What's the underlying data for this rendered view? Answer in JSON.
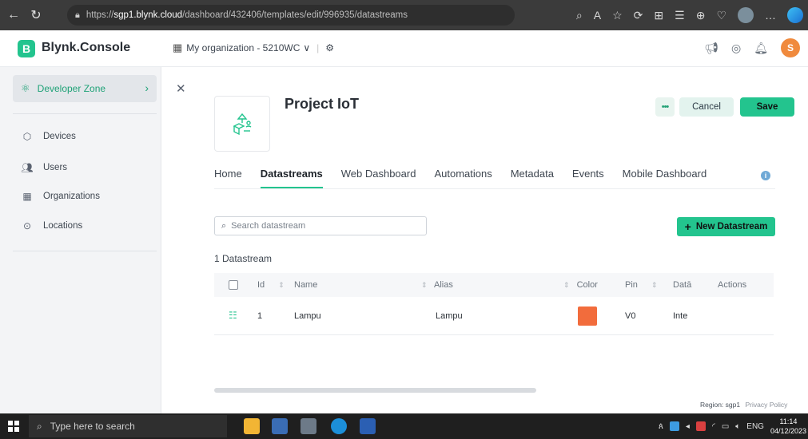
{
  "browser": {
    "url_prefix": "https://",
    "url_host": "sgp1.blynk.cloud",
    "url_path": "/dashboard/432406/templates/edit/996935/datastreams"
  },
  "header": {
    "logo_letter": "B",
    "app_name": "Blynk.Console",
    "org_name": "My organization - 5210WC",
    "user_initial": "S"
  },
  "sidebar": {
    "developer_zone": "Developer Zone",
    "items": [
      {
        "label": "Devices",
        "icon": "cube-icon"
      },
      {
        "label": "Users",
        "icon": "users-icon"
      },
      {
        "label": "Organizations",
        "icon": "building-icon"
      },
      {
        "label": "Locations",
        "icon": "location-pin-icon"
      }
    ]
  },
  "main": {
    "project_title": "Project IoT",
    "more_label": "•••",
    "cancel_label": "Cancel",
    "save_label": "Save",
    "tabs": [
      {
        "label": "Home",
        "active": false
      },
      {
        "label": "Datastreams",
        "active": true
      },
      {
        "label": "Web Dashboard",
        "active": false
      },
      {
        "label": "Automations",
        "active": false
      },
      {
        "label": "Metadata",
        "active": false
      },
      {
        "label": "Events",
        "active": false
      },
      {
        "label": "Mobile Dashboard",
        "active": false
      }
    ],
    "search_placeholder": "Search datastream",
    "new_datastream_label": "New Datastream",
    "count_label": "1 Datastream",
    "table": {
      "headers": {
        "id": "Id",
        "name": "Name",
        "alias": "Alias",
        "color": "Color",
        "pin": "Pin",
        "data_type": "Datā",
        "actions": "Actions"
      },
      "rows": [
        {
          "id": "1",
          "name": "Lampu",
          "alias": "Lampu",
          "color": "#f26c3c",
          "pin": "V0",
          "data_type": "Inte"
        }
      ]
    },
    "region_label": "Region: sgp1",
    "privacy_label": "Privacy Policy"
  },
  "taskbar": {
    "search_placeholder": "Type here to search",
    "language": "ENG",
    "time": "11:14",
    "date": "04/12/2023"
  },
  "colors": {
    "brand_green": "#23c48e",
    "lampu_color": "#f26c3c"
  }
}
